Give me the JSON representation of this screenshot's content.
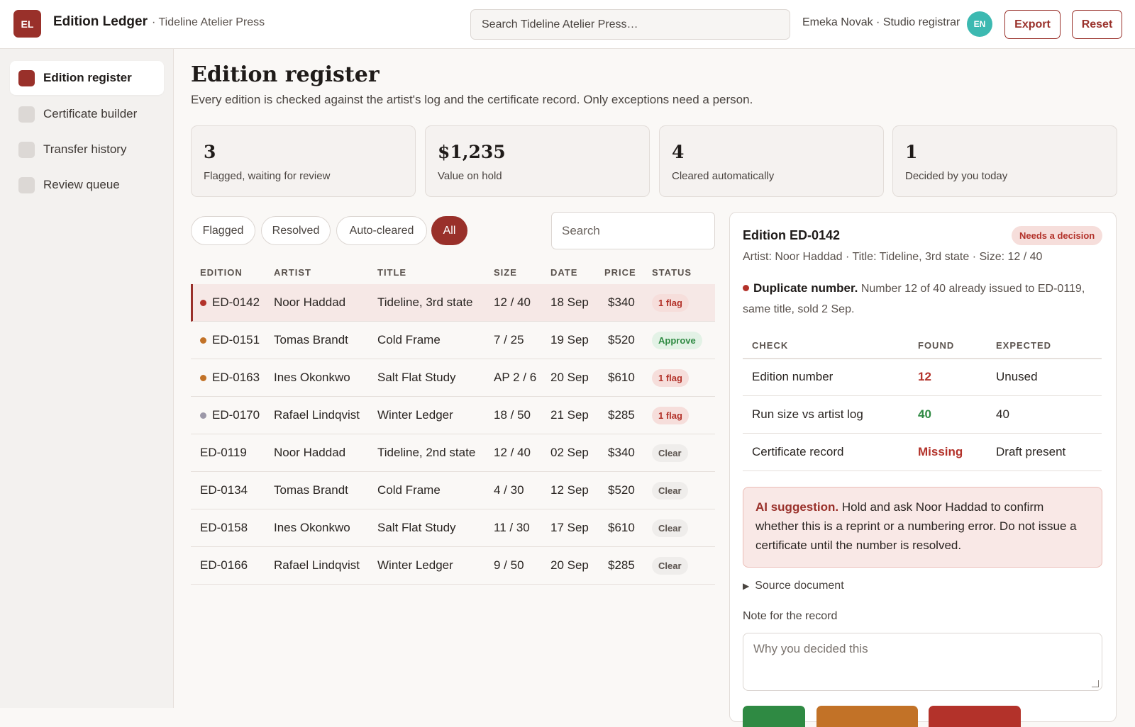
{
  "header": {
    "logo": "EL",
    "app_name": "Edition Ledger",
    "org": "· Tideline Atelier Press",
    "search_placeholder": "Search Tideline Atelier Press…",
    "user": "Emeka Novak · Studio registrar",
    "avatar": "EN",
    "export_label": "Export",
    "reset_label": "Reset"
  },
  "sidebar": {
    "items": [
      {
        "label": "Edition register",
        "active": true
      },
      {
        "label": "Certificate builder"
      },
      {
        "label": "Transfer history"
      },
      {
        "label": "Review queue"
      }
    ]
  },
  "page": {
    "title": "Edition register",
    "subtitle": "Every edition is checked against the artist's log and the certificate record. Only exceptions need a person."
  },
  "stats": [
    {
      "value": "3",
      "label": "Flagged, waiting for review"
    },
    {
      "value": "$1,235",
      "label": "Value on hold"
    },
    {
      "value": "4",
      "label": "Cleared automatically"
    },
    {
      "value": "1",
      "label": "Decided by you today"
    }
  ],
  "filters": {
    "chips": [
      "Flagged",
      "Resolved",
      "Auto-cleared",
      "All"
    ],
    "active": "All",
    "search_placeholder": "Search"
  },
  "table": {
    "headers": [
      "EDITION",
      "ARTIST",
      "TITLE",
      "SIZE",
      "DATE",
      "PRICE",
      "STATUS"
    ],
    "rows": [
      {
        "edition": "ED-0142",
        "artist": "Noor Haddad",
        "title": "Tideline, 3rd state",
        "size": "12 / 40",
        "date": "18 Sep",
        "price": "$340",
        "status": "1 flag",
        "dot": "#b3322a"
      },
      {
        "edition": "ED-0151",
        "artist": "Tomas Brandt",
        "title": "Cold Frame",
        "size": "7 / 25",
        "date": "19 Sep",
        "price": "$520",
        "status": "Approve",
        "dot": "#c27227"
      },
      {
        "edition": "ED-0163",
        "artist": "Ines Okonkwo",
        "title": "Salt Flat Study",
        "size": "AP 2 / 6",
        "date": "20 Sep",
        "price": "$610",
        "status": "1 flag",
        "dot": "#c27227"
      },
      {
        "edition": "ED-0170",
        "artist": "Rafael Lindqvist",
        "title": "Winter Ledger",
        "size": "18 / 50",
        "date": "21 Sep",
        "price": "$285",
        "status": "1 flag",
        "dot": "#9c98a8"
      },
      {
        "edition": "ED-0119",
        "artist": "Noor Haddad",
        "title": "Tideline, 2nd state",
        "size": "12 / 40",
        "date": "02 Sep",
        "price": "$340",
        "status": "Clear",
        "dot": null
      },
      {
        "edition": "ED-0134",
        "artist": "Tomas Brandt",
        "title": "Cold Frame",
        "size": "4 / 30",
        "date": "12 Sep",
        "price": "$520",
        "status": "Clear",
        "dot": null
      },
      {
        "edition": "ED-0158",
        "artist": "Ines Okonkwo",
        "title": "Salt Flat Study",
        "size": "11 / 30",
        "date": "17 Sep",
        "price": "$610",
        "status": "Clear",
        "dot": null
      },
      {
        "edition": "ED-0166",
        "artist": "Rafael Lindqvist",
        "title": "Winter Ledger",
        "size": "9 / 50",
        "date": "20 Sep",
        "price": "$285",
        "status": "Clear",
        "dot": null
      }
    ]
  },
  "detail": {
    "title": "Edition ED-0142",
    "badge": "Needs a decision",
    "meta": "Artist: Noor Haddad · Title: Tideline, 3rd state · Size: 12 / 40",
    "issue_title": "Duplicate number.",
    "issue_text": "Number 12 of 40 already issued to ED-0119, same title, sold 2 Sep.",
    "checks_headers": [
      "CHECK",
      "FOUND",
      "EXPECTED"
    ],
    "checks": [
      {
        "check": "Edition number",
        "found": "12",
        "expected": "Unused",
        "tone": "red"
      },
      {
        "check": "Run size vs artist log",
        "found": "40",
        "expected": "40",
        "tone": "green"
      },
      {
        "check": "Certificate record",
        "found": "Missing",
        "expected": "Draft present",
        "tone": "red"
      }
    ],
    "ai_label": "AI suggestion.",
    "ai_text": "Hold and ask Noor Haddad to confirm whether this is a reprint or a numbering error. Do not issue a certificate until the number is resolved.",
    "source_label": "Source document",
    "note_label": "Note for the record",
    "note_placeholder": "Why you decided this"
  },
  "colors": {
    "accent": "#99302a",
    "flag": "#b3322a",
    "approve": "#2f8a43",
    "avatar": "#3cb9b1"
  }
}
